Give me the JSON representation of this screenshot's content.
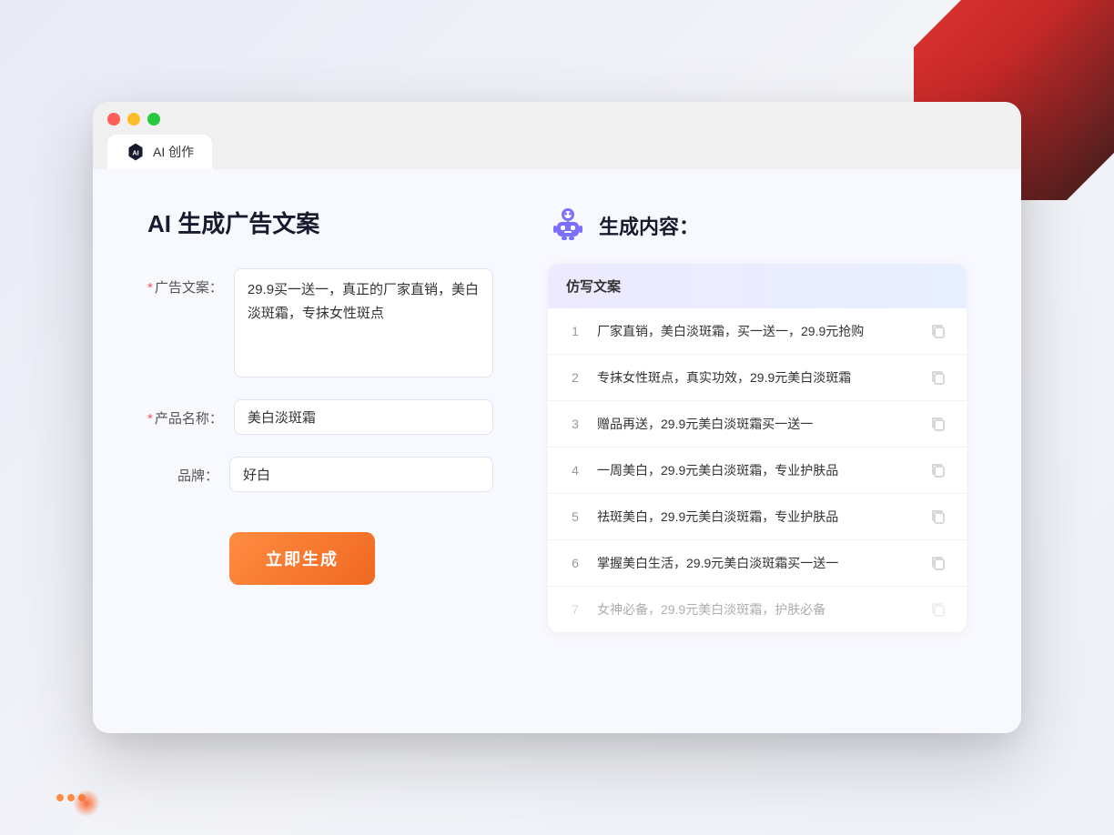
{
  "window": {
    "controls": {
      "close_label": "close",
      "minimize_label": "minimize",
      "maximize_label": "maximize"
    },
    "tab": {
      "label": "AI 创作"
    }
  },
  "left_panel": {
    "title": "AI 生成广告文案",
    "form": {
      "ad_copy_label": "广告文案：",
      "ad_copy_required": "*",
      "ad_copy_value": "29.9买一送一，真正的厂家直销，美白淡斑霜，专抹女性斑点",
      "product_name_label": "产品名称：",
      "product_name_required": "*",
      "product_name_value": "美白淡斑霜",
      "brand_label": "品牌：",
      "brand_value": "好白"
    },
    "generate_btn": "立即生成"
  },
  "right_panel": {
    "title": "生成内容：",
    "table_header": "仿写文案",
    "results": [
      {
        "num": "1",
        "text": "厂家直销，美白淡斑霜，买一送一，29.9元抢购"
      },
      {
        "num": "2",
        "text": "专抹女性斑点，真实功效，29.9元美白淡斑霜"
      },
      {
        "num": "3",
        "text": "赠品再送，29.9元美白淡斑霜买一送一"
      },
      {
        "num": "4",
        "text": "一周美白，29.9元美白淡斑霜，专业护肤品"
      },
      {
        "num": "5",
        "text": "祛斑美白，29.9元美白淡斑霜，专业护肤品"
      },
      {
        "num": "6",
        "text": "掌握美白生活，29.9元美白淡斑霜买一送一"
      },
      {
        "num": "7",
        "text": "女神必备，29.9元美白淡斑霜，护肤必备",
        "faded": true
      }
    ]
  }
}
